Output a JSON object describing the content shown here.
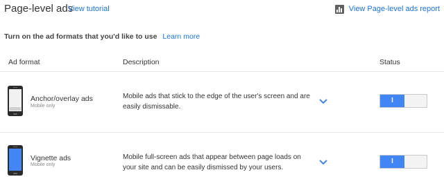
{
  "header": {
    "title": "Page-level ads",
    "tutorial_link": "View tutorial",
    "report_link": "View Page-level ads report",
    "report_icon": "bar-chart-icon"
  },
  "intro": {
    "text": "Turn on the ad formats that you'd like to use",
    "learn_more": "Learn more"
  },
  "table": {
    "columns": [
      "Ad format",
      "Description",
      "Status"
    ],
    "rows": [
      {
        "name": "Anchor/overlay ads",
        "subtitle": "Mobile only",
        "description": "Mobile ads that stick to the edge of the user's screen and are easily dismissable.",
        "status_label": "I",
        "status_on": true
      },
      {
        "name": "Vignette ads",
        "subtitle": "Mobile only",
        "description": "Mobile full-screen ads that appear between page loads on your site and can be easily dismissed by your users.",
        "status_label": "I",
        "status_on": true
      }
    ]
  },
  "colors": {
    "accent": "#4285f4",
    "link": "#1a73e8"
  }
}
